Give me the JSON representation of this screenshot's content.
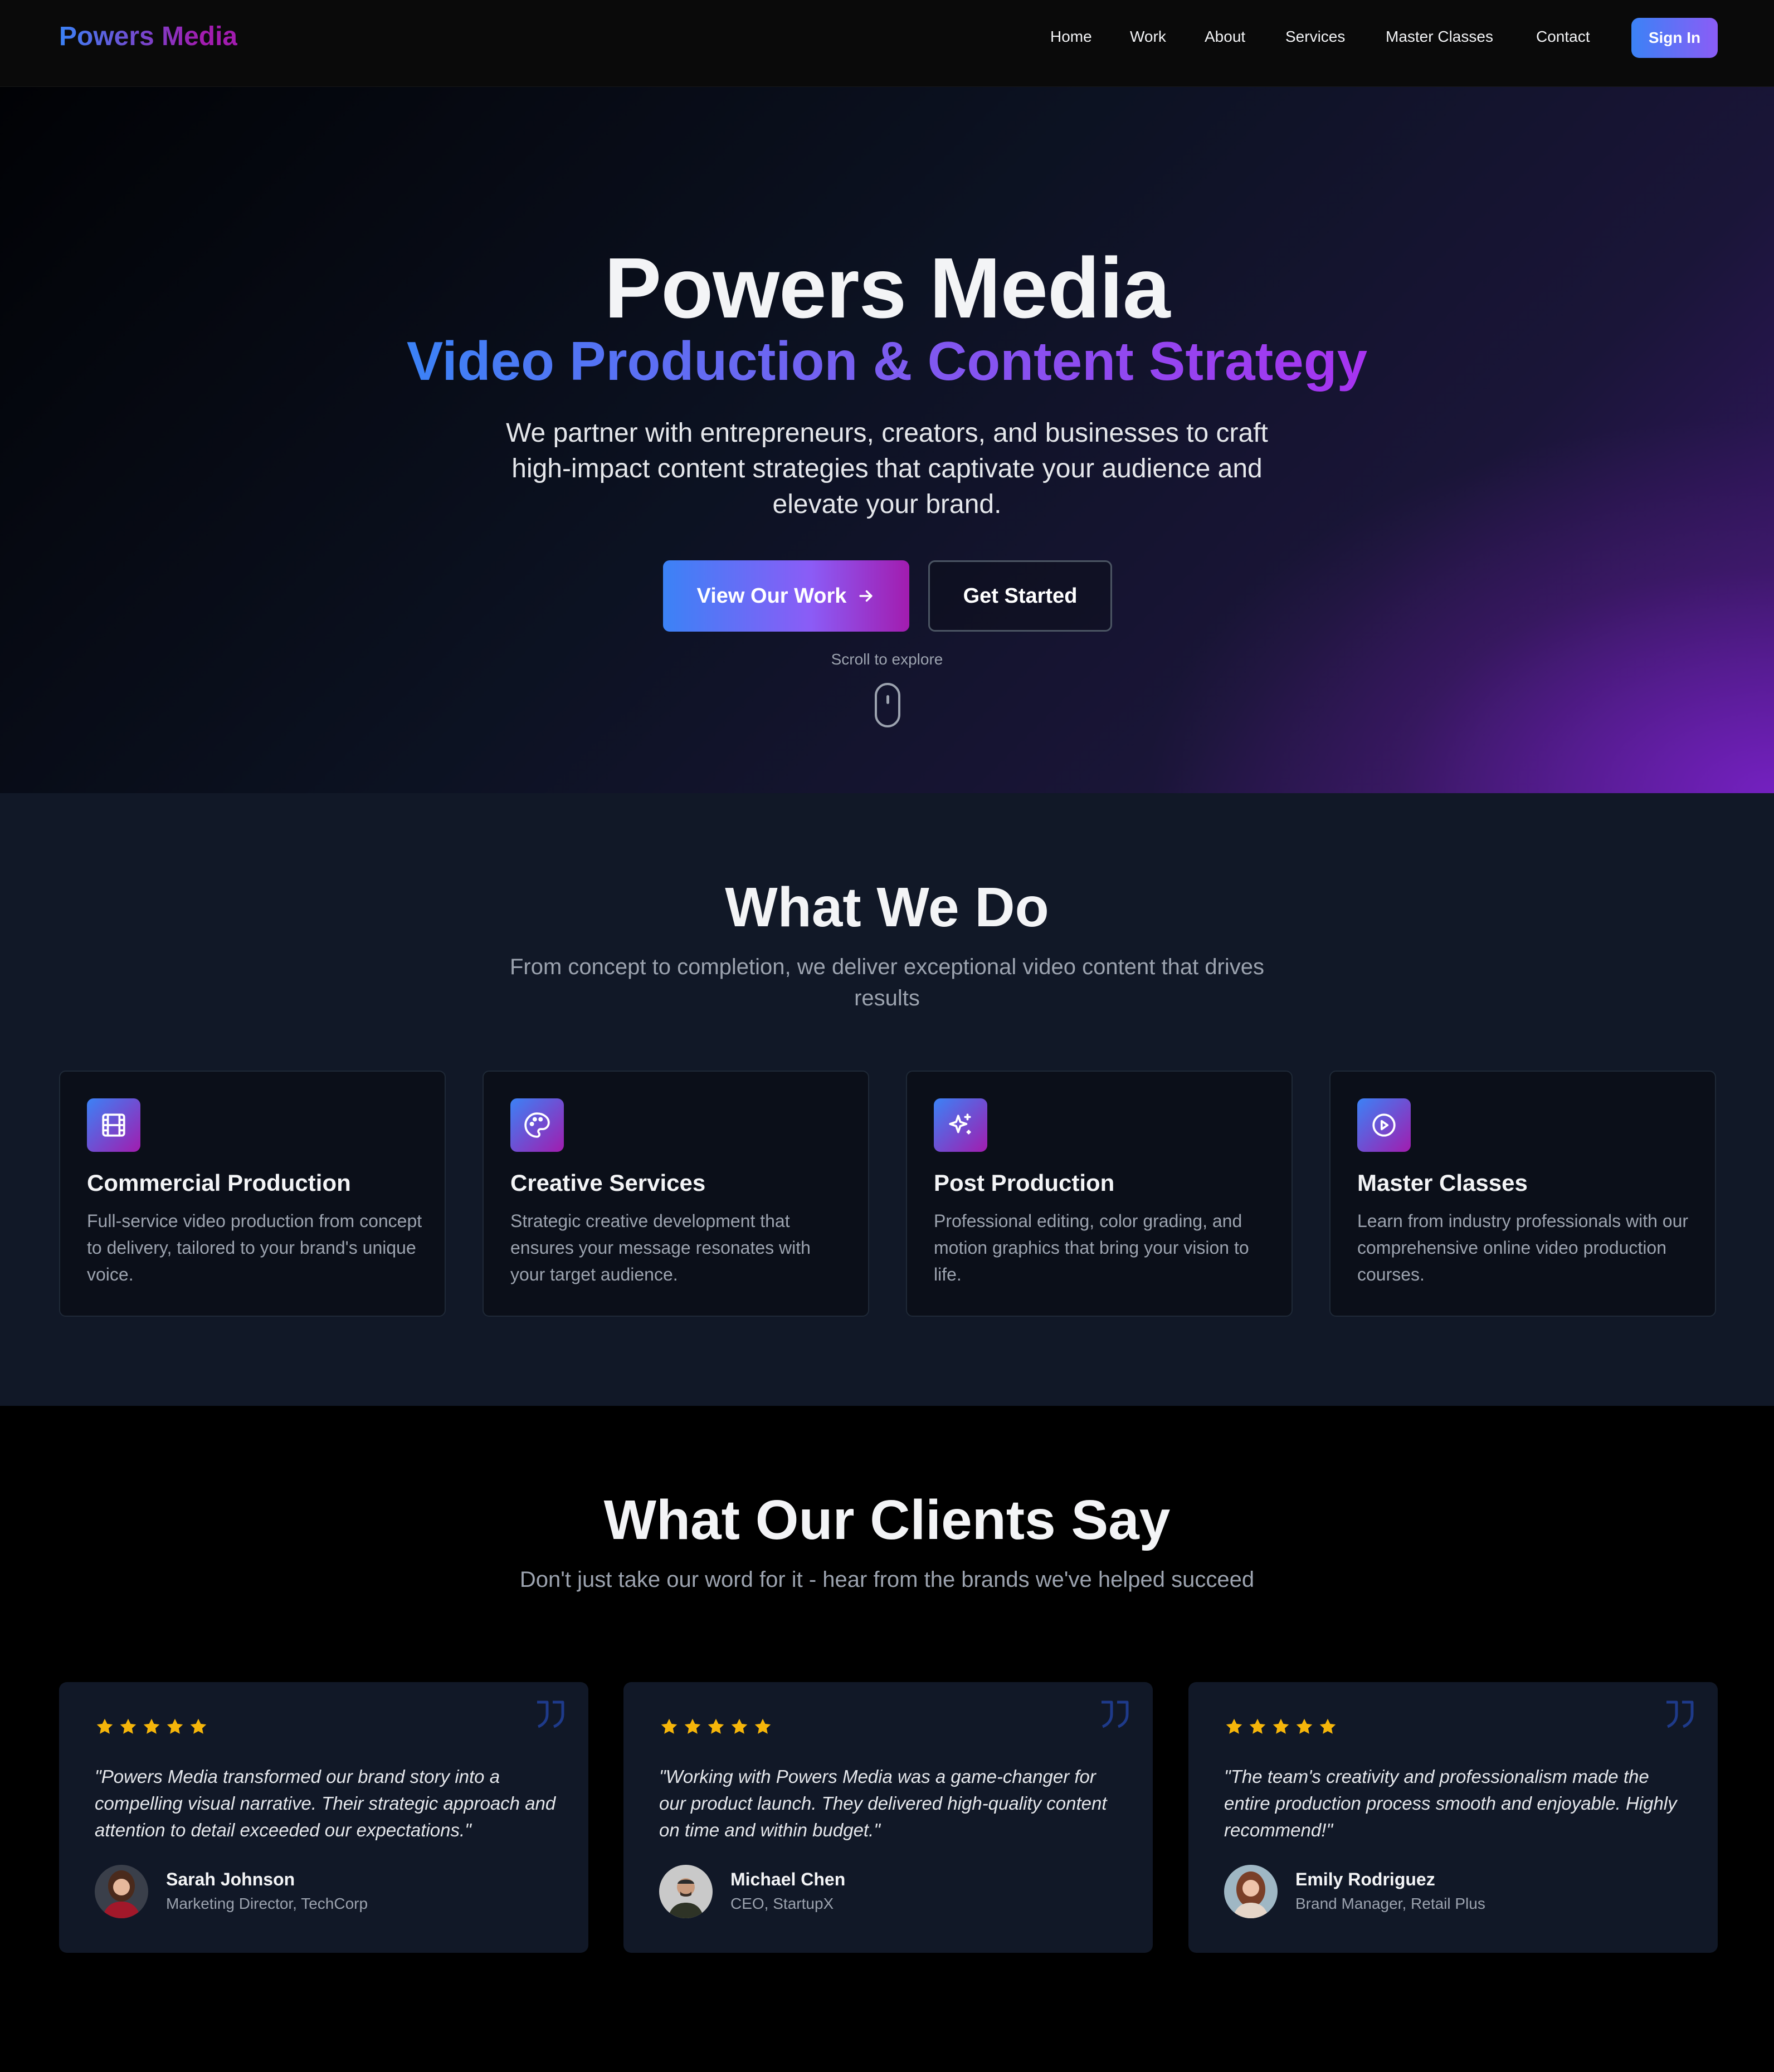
{
  "nav": {
    "brand": "Powers Media",
    "links": [
      "Home",
      "Work",
      "About",
      "Services",
      "Master Classes",
      "Contact"
    ],
    "signin": "Sign In"
  },
  "hero": {
    "title": "Powers Media",
    "subtitle": "Video Production & Content Strategy",
    "description": "We partner with entrepreneurs, creators, and businesses to craft high-impact content strategies that captivate your audience and elevate your brand.",
    "primary_button": "View Our Work",
    "secondary_button": "Get Started",
    "scroll_hint": "Scroll to explore"
  },
  "services": {
    "title": "What We Do",
    "description": "From concept to completion, we deliver exceptional video content that drives results",
    "cards": [
      {
        "icon": "film-icon",
        "title": "Commercial Production",
        "desc": "Full-service video production from concept to delivery, tailored to your brand's unique voice."
      },
      {
        "icon": "palette-icon",
        "title": "Creative Services",
        "desc": "Strategic creative development that ensures your message resonates with your target audience."
      },
      {
        "icon": "sparkles-icon",
        "title": "Post Production",
        "desc": "Professional editing, color grading, and motion graphics that bring your vision to life."
      },
      {
        "icon": "play-circle-icon",
        "title": "Master Classes",
        "desc": "Learn from industry professionals with our comprehensive online video production courses."
      }
    ]
  },
  "testimonials": {
    "title": "What Our Clients Say",
    "description": "Don't just take our word for it - hear from the brands we've helped succeed",
    "rating": 5,
    "items": [
      {
        "quote": "\"Powers Media transformed our brand story into a compelling visual narrative. Their strategic approach and attention to detail exceeded our expectations.\"",
        "name": "Sarah Johnson",
        "role": "Marketing Director, TechCorp"
      },
      {
        "quote": "\"Working with Powers Media was a game-changer for our product launch. They delivered high-quality content on time and within budget.\"",
        "name": "Michael Chen",
        "role": "CEO, StartupX"
      },
      {
        "quote": "\"The team's creativity and professionalism made the entire production process smooth and enjoyable. Highly recommend!\"",
        "name": "Emily Rodriguez",
        "role": "Brand Manager, Retail Plus"
      }
    ]
  },
  "colors": {
    "accent_blue": "#3b82f6",
    "accent_purple": "#a21caf",
    "star": "#f5b50a",
    "background": "#000000",
    "section_bg": "#111827"
  }
}
